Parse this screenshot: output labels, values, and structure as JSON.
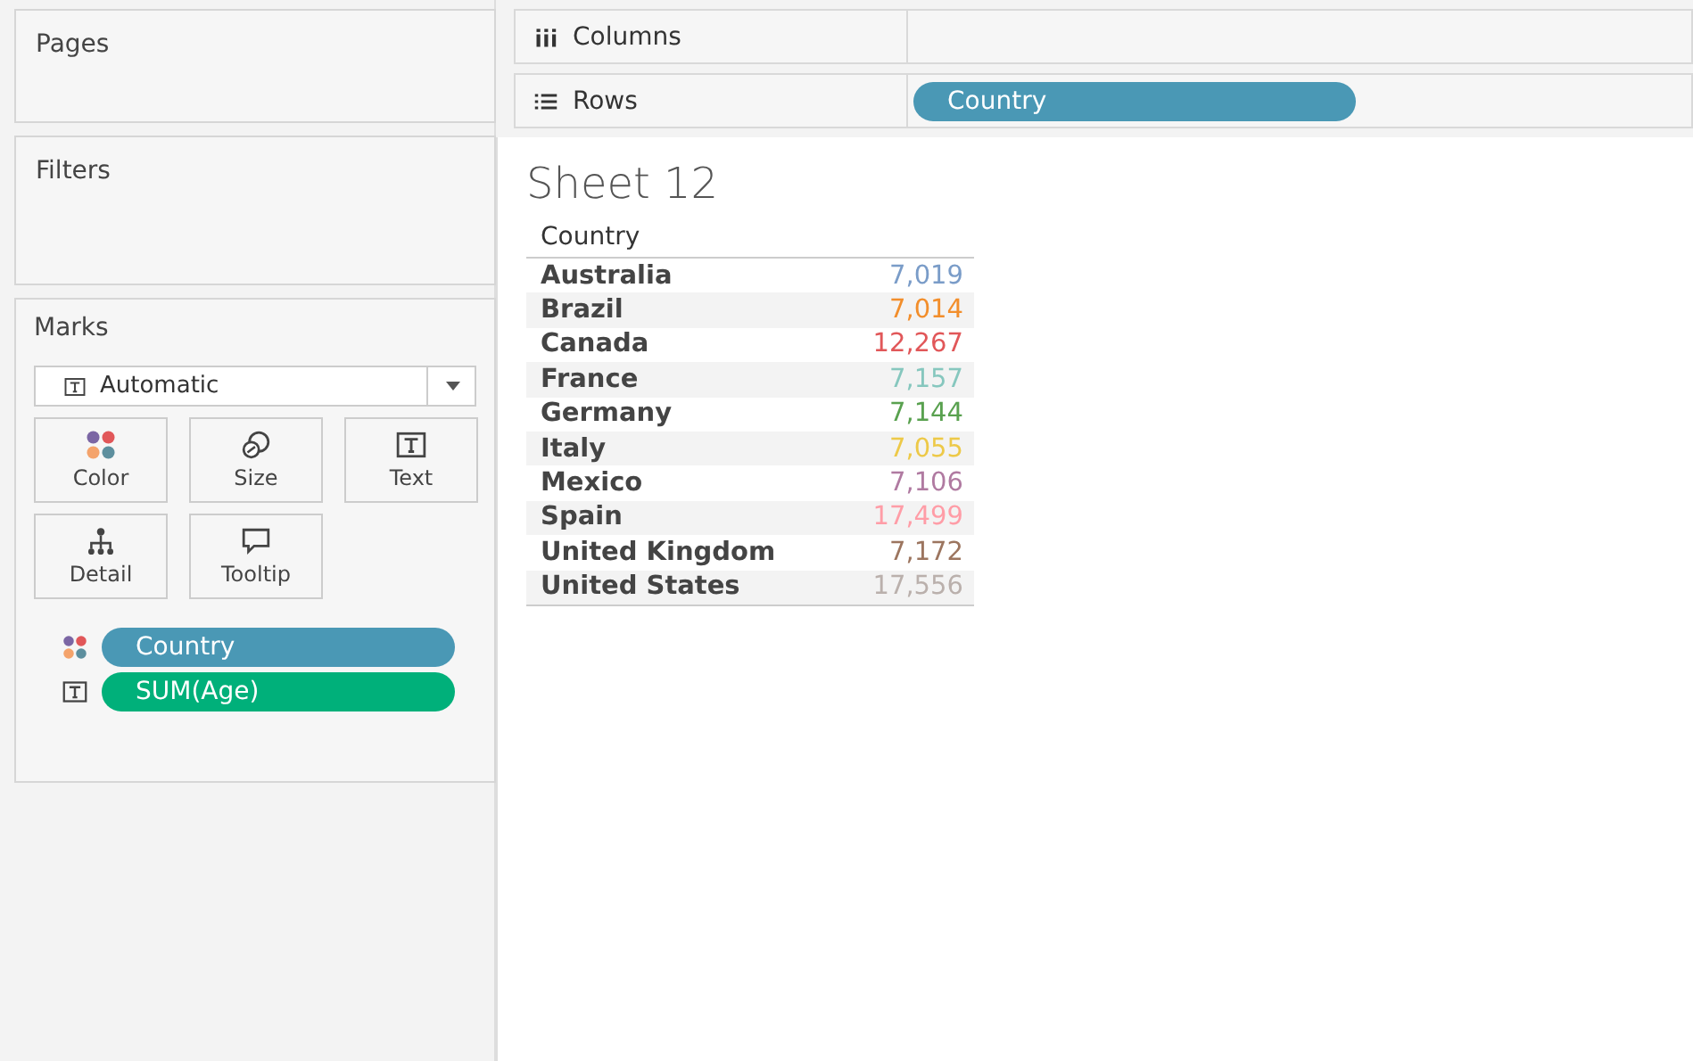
{
  "cards": [
    {
      "title": "Pages"
    },
    {
      "title": "Filters"
    }
  ],
  "marks": {
    "title": "Marks",
    "mark_type": "Automatic",
    "buttons": [
      {
        "kind": "color",
        "label": "Color"
      },
      {
        "kind": "size",
        "label": "Size"
      },
      {
        "kind": "text",
        "label": "Text"
      },
      {
        "kind": "detail",
        "label": "Detail"
      },
      {
        "kind": "tooltip",
        "label": "Tooltip"
      }
    ],
    "pills": [
      {
        "kind": "color",
        "label": "Country",
        "color": "#4a98b5"
      },
      {
        "kind": "text",
        "label": "SUM(Age)",
        "color": "#00b07a"
      }
    ]
  },
  "shelves": [
    {
      "kind": "columns",
      "label": "Columns"
    },
    {
      "kind": "rows",
      "label": "Rows",
      "pills": [
        {
          "label": "Country",
          "color": "#4a98b5"
        }
      ]
    }
  ],
  "sheet": {
    "title": "Sheet 12",
    "header": "Country",
    "rows": [
      {
        "name": "Australia",
        "value": "7,019",
        "color": "#7a9cc8"
      },
      {
        "name": "Brazil",
        "value": "7,014",
        "color": "#f28e2b"
      },
      {
        "name": "Canada",
        "value": "12,267",
        "color": "#e15759"
      },
      {
        "name": "France",
        "value": "7,157",
        "color": "#86c7be"
      },
      {
        "name": "Germany",
        "value": "7,144",
        "color": "#59a14f"
      },
      {
        "name": "Italy",
        "value": "7,055",
        "color": "#edc948"
      },
      {
        "name": "Mexico",
        "value": "7,106",
        "color": "#b07aa1"
      },
      {
        "name": "Spain",
        "value": "17,499",
        "color": "#ff9da7"
      },
      {
        "name": "United Kingdom",
        "value": "7,172",
        "color": "#9c755f"
      },
      {
        "name": "United States",
        "value": "17,556",
        "color": "#bab0ac"
      }
    ]
  }
}
